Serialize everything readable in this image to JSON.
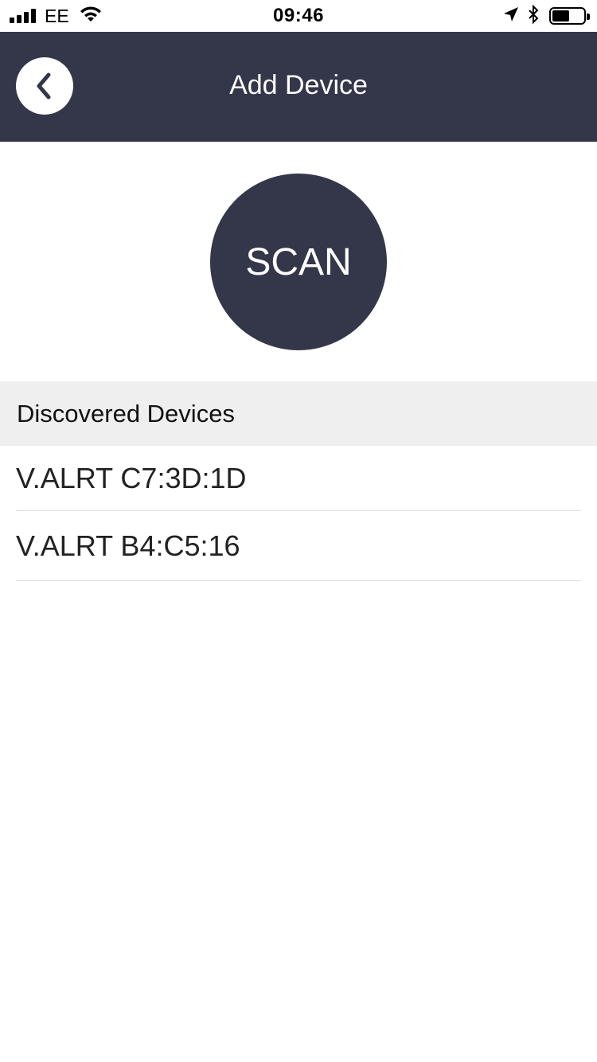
{
  "status_bar": {
    "carrier": "EE",
    "time": "09:46",
    "battery_level": 0.55,
    "icons": [
      "signal-icon",
      "wifi-icon",
      "location-icon",
      "bluetooth-icon",
      "battery-icon"
    ]
  },
  "nav": {
    "title": "Add Device",
    "back_icon": "chevron-left-icon"
  },
  "scan": {
    "label": "SCAN"
  },
  "discovered": {
    "header": "Discovered Devices",
    "devices": [
      {
        "name": "V.ALRT C7:3D:1D"
      },
      {
        "name": "V.ALRT B4:C5:16"
      }
    ]
  },
  "colors": {
    "primary": "#34364a",
    "section_bg": "#efefef",
    "background": "#ffffff"
  }
}
